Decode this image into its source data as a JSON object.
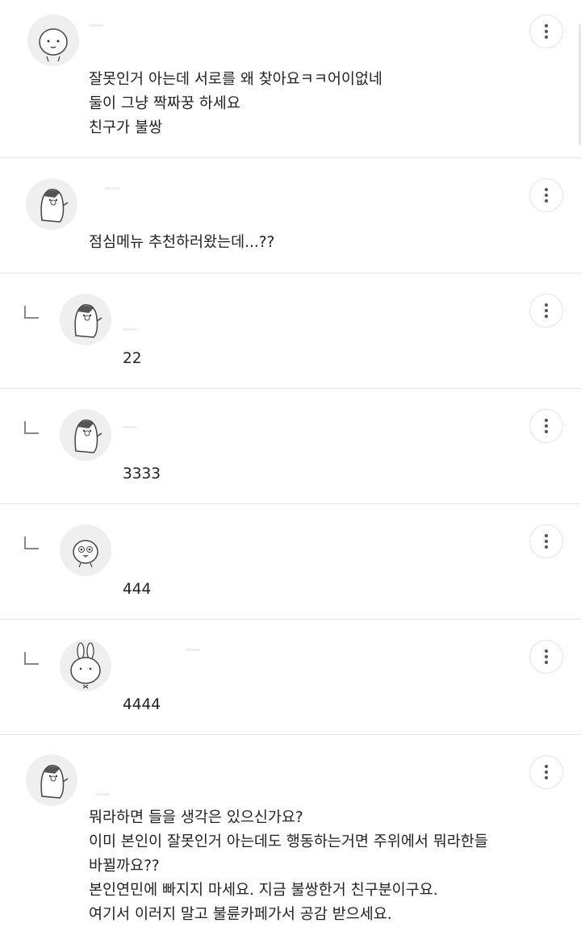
{
  "comments": [
    {
      "type": "comment",
      "avatar_icon": "baby-face-avatar-icon",
      "text": "잘못인거 아는데 서로를 왜 찾아요ㅋㅋ어이없네\n둘이 그냥 짝짜꿍 하세요\n친구가 불쌍",
      "more_label": "더보기"
    },
    {
      "type": "comment",
      "avatar_icon": "bird-character-avatar-icon",
      "text": "점심메뉴 추천하러왔는데...??",
      "more_label": "더보기"
    },
    {
      "type": "reply",
      "avatar_icon": "bird-character-avatar-icon",
      "text": "22",
      "more_label": "더보기"
    },
    {
      "type": "reply",
      "avatar_icon": "bird-character-avatar-icon",
      "text": "3333",
      "more_label": "더보기"
    },
    {
      "type": "reply",
      "avatar_icon": "chick-character-avatar-icon",
      "text": "444",
      "more_label": "더보기"
    },
    {
      "type": "reply",
      "avatar_icon": "rabbit-character-avatar-icon",
      "text": "4444",
      "more_label": "더보기"
    },
    {
      "type": "comment",
      "avatar_icon": "bird-character-avatar-icon",
      "text": "뭐라하면 들을 생각은 있으신가요?\n이미 본인이 잘못인거 아는데도 행동하는거면 주위에서 뭐라한들\n바뀔까요??\n본인연민에 빠지지 마세요. 지금 불쌍한거 친구분이구요.\n여기서 이러지 말고 불륜카페가서 공감 받으세요.",
      "more_label": "더보기"
    }
  ],
  "colors": {
    "text": "#222222",
    "divider": "#e6e6e6",
    "avatar_bg": "#efefef",
    "icon": "#555555"
  }
}
